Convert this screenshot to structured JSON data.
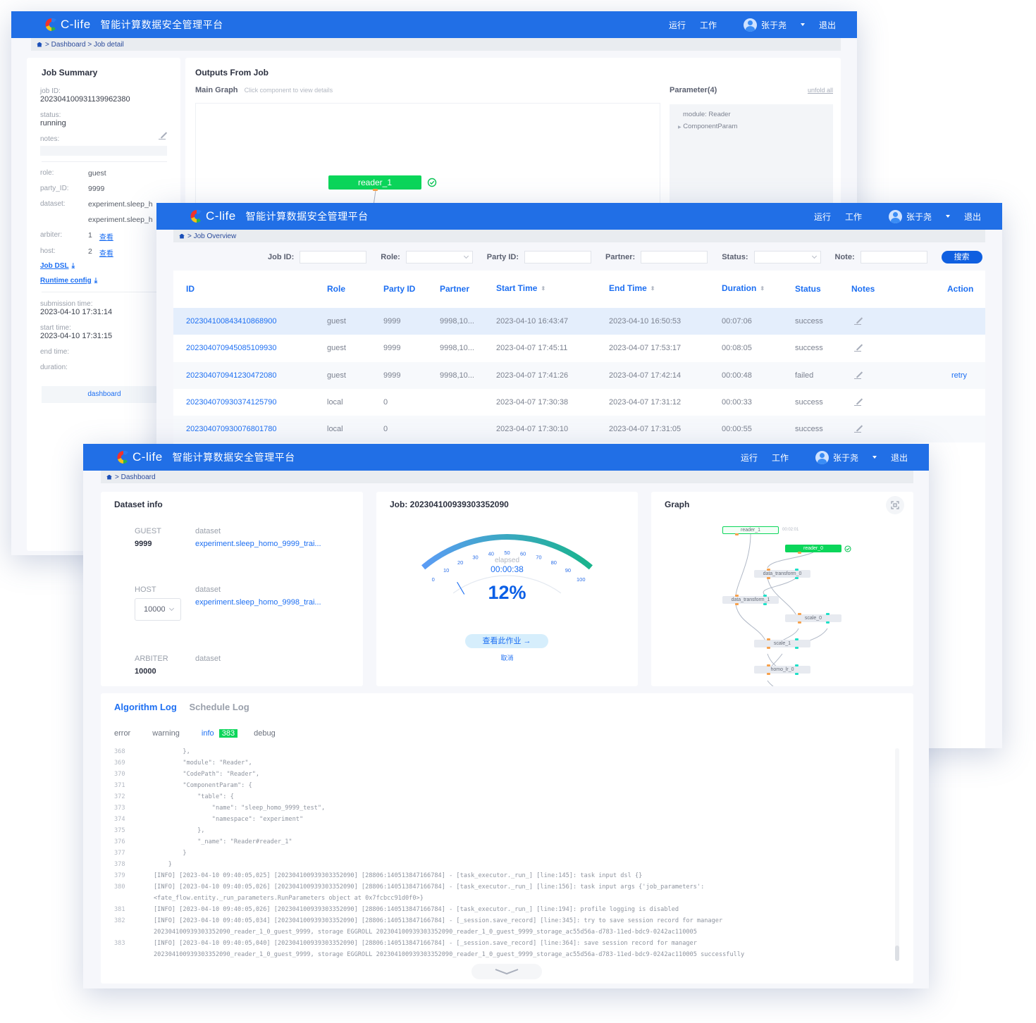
{
  "brand": {
    "logo_text": "C-life",
    "app_title": "智能计算数据安全管理平台",
    "colors": {
      "primary": "#216fe6",
      "link": "#1d6ff2",
      "success_green": "#0bd65a",
      "gauge_start": "#5b9cf5",
      "gauge_end": "#19b48c"
    }
  },
  "topnav": {
    "run": "运行",
    "work": "工作",
    "user": "张于尧",
    "logout": "退出"
  },
  "job_detail": {
    "breadcrumb": [
      "Dashboard",
      "Job detail"
    ],
    "summary": {
      "title": "Job Summary",
      "job_id_label": "job ID:",
      "job_id": "202304100931139962380",
      "status_label": "status:",
      "status": "running",
      "notes_label": "notes:",
      "role_label": "role:",
      "role": "guest",
      "party_id_label": "party_ID:",
      "party_id": "9999",
      "dataset_label": "dataset:",
      "dataset_1": "experiment.sleep_h",
      "dataset_2": "experiment.sleep_h",
      "arbiter_label": "arbiter:",
      "arbiter_count": "1",
      "host_label": "host:",
      "host_count": "2",
      "view_link": "查看",
      "job_dsl": "Job DSL",
      "runtime_config": "Runtime config",
      "submission_label": "submission time:",
      "submission_time": "2023-04-10 17:31:14",
      "start_label": "start time:",
      "start_time": "2023-04-10 17:31:15",
      "end_label": "end time:",
      "duration_label": "duration:",
      "dashboard_button": "dashboard"
    },
    "outputs": {
      "title": "Outputs From Job",
      "main_graph": "Main Graph",
      "hint": "Click component to view details",
      "node": "reader_1",
      "parameter_title": "Parameter(4)",
      "unfold_all": "unfold all",
      "param_module": "module: Reader",
      "param_component": "ComponentParam"
    }
  },
  "job_overview": {
    "breadcrumb": [
      "Job Overview"
    ],
    "filters": {
      "job_id": "Job ID:",
      "role": "Role:",
      "party_id": "Party ID:",
      "partner": "Partner:",
      "status": "Status:",
      "note": "Note:",
      "search_button": "搜索"
    },
    "columns": [
      "ID",
      "Role",
      "Party ID",
      "Partner",
      "Start Time",
      "End Time",
      "Duration",
      "Status",
      "Notes",
      "Action"
    ],
    "rows": [
      {
        "id": "202304100843410868900",
        "role": "guest",
        "party_id": "9999",
        "partner": "9998,10...",
        "start": "2023-04-10 16:43:47",
        "end": "2023-04-10 16:50:53",
        "duration": "00:07:06",
        "status": "success",
        "action": ""
      },
      {
        "id": "202304070945085109930",
        "role": "guest",
        "party_id": "9999",
        "partner": "9998,10...",
        "start": "2023-04-07 17:45:11",
        "end": "2023-04-07 17:53:17",
        "duration": "00:08:05",
        "status": "success",
        "action": ""
      },
      {
        "id": "202304070941230472080",
        "role": "guest",
        "party_id": "9999",
        "partner": "9998,10...",
        "start": "2023-04-07 17:41:26",
        "end": "2023-04-07 17:42:14",
        "duration": "00:00:48",
        "status": "failed",
        "action": "retry"
      },
      {
        "id": "202304070930374125790",
        "role": "local",
        "party_id": "0",
        "partner": "",
        "start": "2023-04-07 17:30:38",
        "end": "2023-04-07 17:31:12",
        "duration": "00:00:33",
        "status": "success",
        "action": ""
      },
      {
        "id": "202304070930076801780",
        "role": "local",
        "party_id": "0",
        "partner": "",
        "start": "2023-04-07 17:30:10",
        "end": "2023-04-07 17:31:05",
        "duration": "00:00:55",
        "status": "success",
        "action": ""
      }
    ]
  },
  "dashboard": {
    "breadcrumb": [
      "Dashboard"
    ],
    "dataset_info": {
      "title": "Dataset info",
      "guest_label": "GUEST",
      "guest_id": "9999",
      "dataset_label": "dataset",
      "guest_dataset": "experiment.sleep_homo_9999_trai...",
      "host_label": "HOST",
      "host_select": "10000",
      "host_dataset": "experiment.sleep_homo_9998_trai...",
      "arbiter_label": "ARBITER",
      "arbiter_id": "10000"
    },
    "job": {
      "title": "Job: 202304100939303352090",
      "gauge_ticks": [
        "0",
        "10",
        "20",
        "30",
        "40",
        "50",
        "60",
        "70",
        "80",
        "90",
        "100"
      ],
      "progress_percent": 12,
      "progress_label": "12%",
      "elapsed_label": "elapsed",
      "elapsed": "00:00:38",
      "view_button": "查看此作业 →",
      "cancel": "取消"
    },
    "graph": {
      "title": "Graph",
      "reader_1_time": "00:02:01",
      "nodes": [
        "reader_1",
        "reader_0",
        "data_transform_0",
        "data_transform_1",
        "scale_0",
        "scale_1",
        "homo_lr_0"
      ]
    },
    "logs": {
      "tabs": [
        "Algorithm Log",
        "Schedule Log"
      ],
      "levels": [
        "error",
        "warning",
        "info",
        "debug"
      ],
      "info_count": "383",
      "lines": [
        {
          "n": "368",
          "t": "        },"
        },
        {
          "n": "369",
          "t": "        \"module\": \"Reader\","
        },
        {
          "n": "370",
          "t": "        \"CodePath\": \"Reader\","
        },
        {
          "n": "371",
          "t": "        \"ComponentParam\": {"
        },
        {
          "n": "372",
          "t": "            \"table\": {"
        },
        {
          "n": "373",
          "t": "                \"name\": \"sleep_homo_9999_test\","
        },
        {
          "n": "374",
          "t": "                \"namespace\": \"experiment\""
        },
        {
          "n": "375",
          "t": "            },"
        },
        {
          "n": "376",
          "t": "            \"_name\": \"Reader#reader_1\""
        },
        {
          "n": "377",
          "t": "        }"
        },
        {
          "n": "378",
          "t": "    }"
        },
        {
          "n": "379",
          "t": "[INFO] [2023-04-10 09:40:05,025] [202304100939303352090] [28806:140513847166784] - [task_executor._run_] [line:145]: task input dsl {}"
        },
        {
          "n": "380",
          "t": "[INFO] [2023-04-10 09:40:05,026] [202304100939303352090] [28806:140513847166784] - [task_executor._run_] [line:156]: task input args {'job_parameters':"
        },
        {
          "n": "",
          "t": "<fate_flow.entity._run_parameters.RunParameters object at 0x7fcbcc91d0f0>}"
        },
        {
          "n": "381",
          "t": "[INFO] [2023-04-10 09:40:05,026] [202304100939303352090] [28806:140513847166784] - [task_executor._run_] [line:194]: profile logging is disabled"
        },
        {
          "n": "382",
          "t": "[INFO] [2023-04-10 09:40:05,034] [202304100939303352090] [28806:140513847166784] - [_session.save_record] [line:345]: try to save session record for manager"
        },
        {
          "n": "",
          "t": "202304100939303352090_reader_1_0_guest_9999, storage EGGROLL 202304100939303352090_reader_1_0_guest_9999_storage_ac55d56a-d783-11ed-bdc9-0242ac110005"
        },
        {
          "n": "383",
          "t": "[INFO] [2023-04-10 09:40:05,040] [202304100939303352090] [28806:140513847166784] - [_session.save_record] [line:364]: save session record for manager"
        },
        {
          "n": "",
          "t": "202304100939303352090_reader_1_0_guest_9999, storage EGGROLL 202304100939303352090_reader_1_0_guest_9999_storage_ac55d56a-d783-11ed-bdc9-0242ac110005 successfully"
        }
      ]
    }
  }
}
